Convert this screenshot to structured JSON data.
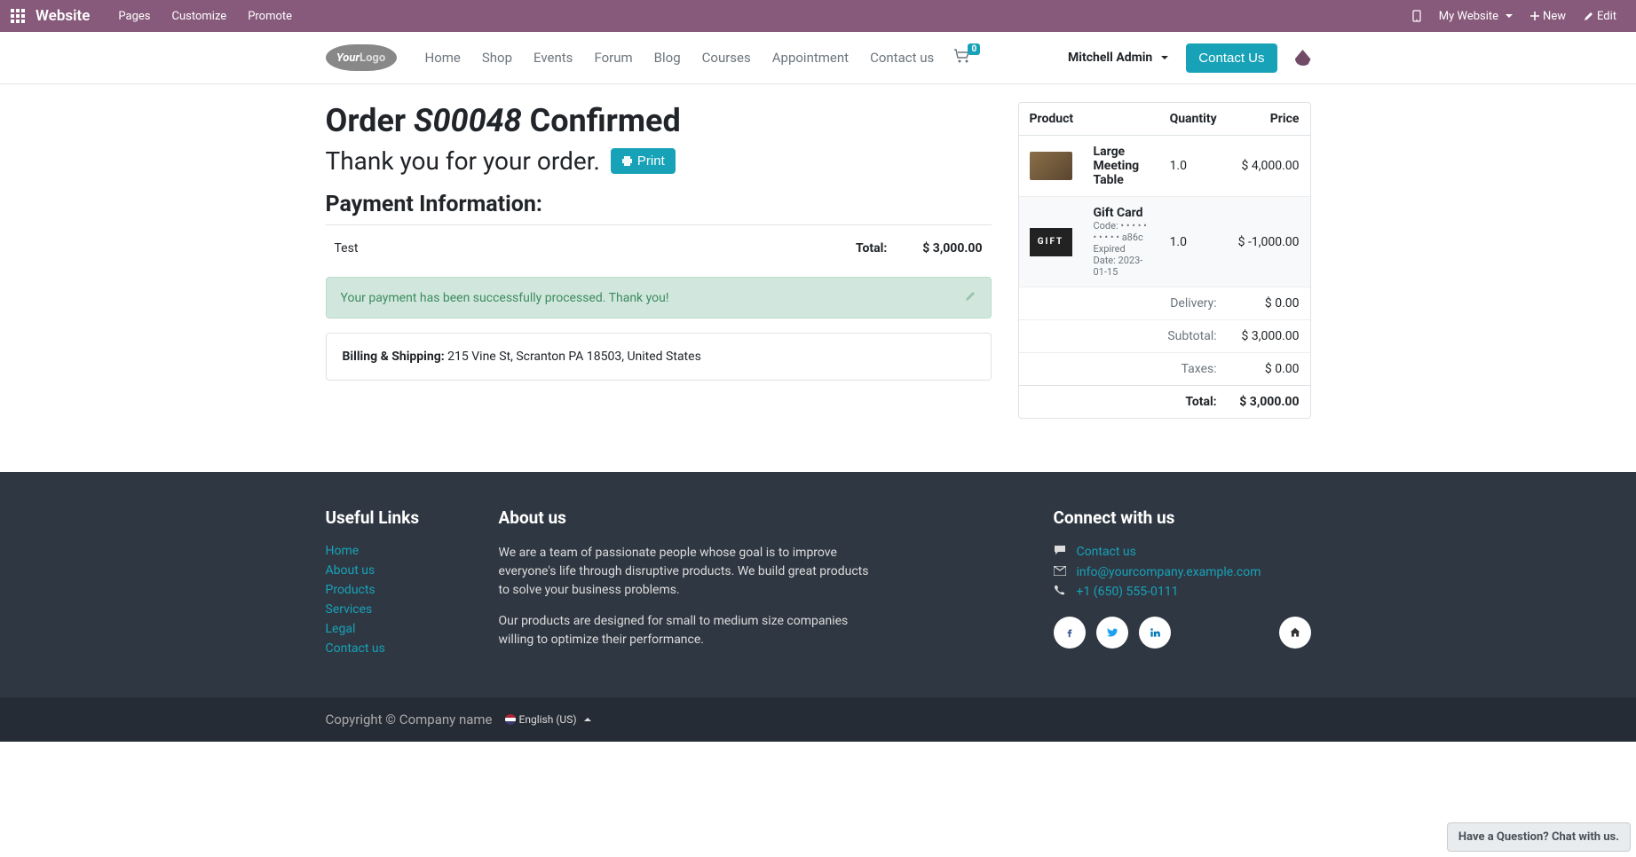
{
  "topbar": {
    "brand": "Website",
    "menu": [
      "Pages",
      "Customize",
      "Promote"
    ],
    "my_website": "My Website",
    "new": "New",
    "edit": "Edit"
  },
  "header": {
    "logo_a": "Your",
    "logo_b": "Logo",
    "nav": [
      "Home",
      "Shop",
      "Events",
      "Forum",
      "Blog",
      "Courses",
      "Appointment",
      "Contact us"
    ],
    "cart_count": "0",
    "user": "Mitchell Admin",
    "contact_btn": "Contact Us"
  },
  "order": {
    "prefix": "Order ",
    "number": "S00048",
    "suffix": " Confirmed",
    "thank": "Thank you for your order.",
    "print": "Print",
    "payment_heading": "Payment Information:",
    "pay_method": "Test",
    "total_label": "Total:",
    "total_amount": "$ 3,000.00",
    "alert": "Your payment has been successfully processed. Thank you!",
    "ship_label": "Billing & Shipping:",
    "ship_addr": "215 Vine St, Scranton PA 18503, United States"
  },
  "summary": {
    "cols": {
      "product": "Product",
      "qty": "Quantity",
      "price": "Price"
    },
    "items": [
      {
        "name": "Large Meeting Table",
        "qty": "1.0",
        "price": "$ 4,000.00",
        "code_lbl": "",
        "code": "",
        "exp_lbl": "",
        "exp": ""
      },
      {
        "name": "Gift Card",
        "qty": "1.0",
        "price": "$ -1,000.00",
        "code_lbl": "Code: ",
        "code": "• • • • • • • • • • a86c",
        "exp_lbl": "Expired Date: ",
        "exp": "2023-01-15"
      }
    ],
    "rows": [
      {
        "label": "Delivery:",
        "value": "$ 0.00"
      },
      {
        "label": "Subtotal:",
        "value": "$ 3,000.00"
      },
      {
        "label": "Taxes:",
        "value": "$ 0.00"
      }
    ],
    "final": {
      "label": "Total:",
      "value": "$ 3,000.00"
    }
  },
  "footer": {
    "links_head": "Useful Links",
    "links": [
      "Home",
      "About us",
      "Products",
      "Services",
      "Legal",
      "Contact us"
    ],
    "about_head": "About us",
    "about_p1": "We are a team of passionate people whose goal is to improve everyone's life through disruptive products. We build great products to solve your business problems.",
    "about_p2": "Our products are designed for small to medium size companies willing to optimize their performance.",
    "connect_head": "Connect with us",
    "contact_link": "Contact us",
    "email": "info@yourcompany.example.com",
    "phone": "+1 (650) 555-0111",
    "copyright": "Copyright © Company name",
    "lang": "English (US)"
  },
  "chat": "Have a Question? Chat with us."
}
